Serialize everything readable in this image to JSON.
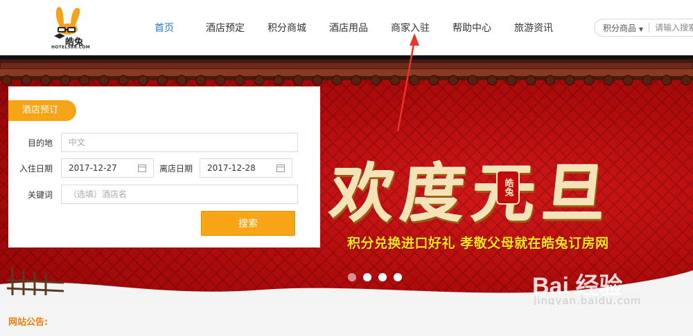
{
  "header": {
    "logo_name": "皓兔",
    "logo_sub": "HOTEL588.COM",
    "nav": [
      {
        "label": "首页",
        "active": true
      },
      {
        "label": "酒店预定",
        "active": false
      },
      {
        "label": "积分商城",
        "active": false
      },
      {
        "label": "酒店用品",
        "active": false
      },
      {
        "label": "商家入驻",
        "active": false
      },
      {
        "label": "帮助中心",
        "active": false
      },
      {
        "label": "旅游资讯",
        "active": false
      }
    ],
    "search": {
      "category": "积分商品",
      "placeholder": "请输入搜索"
    }
  },
  "banner": {
    "headline": "欢度元旦",
    "seal": "皓兔",
    "slogan": "积分兑换进口好礼 孝敬父母就在皓兔订房网",
    "active_slide": 2,
    "watermark": "Bai 经验",
    "watermark_sub": "jingyan.baidu.com"
  },
  "booking": {
    "tab_label": "酒店预订",
    "destination_label": "目的地",
    "destination_placeholder": "中文",
    "checkin_label": "入住日期",
    "checkin_value": "2017-12-27",
    "checkout_label": "离店日期",
    "checkout_value": "2017-12-28",
    "keyword_label": "关键词",
    "keyword_placeholder": "（选填）酒店名",
    "search_label": "搜索"
  },
  "notice": {
    "title": "网站公告:"
  },
  "colors": {
    "nav_active": "#2a7cc7",
    "accent_orange": "#f9a516",
    "banner_red": "#b20c0c",
    "slogan_yellow": "#ffe41a"
  }
}
